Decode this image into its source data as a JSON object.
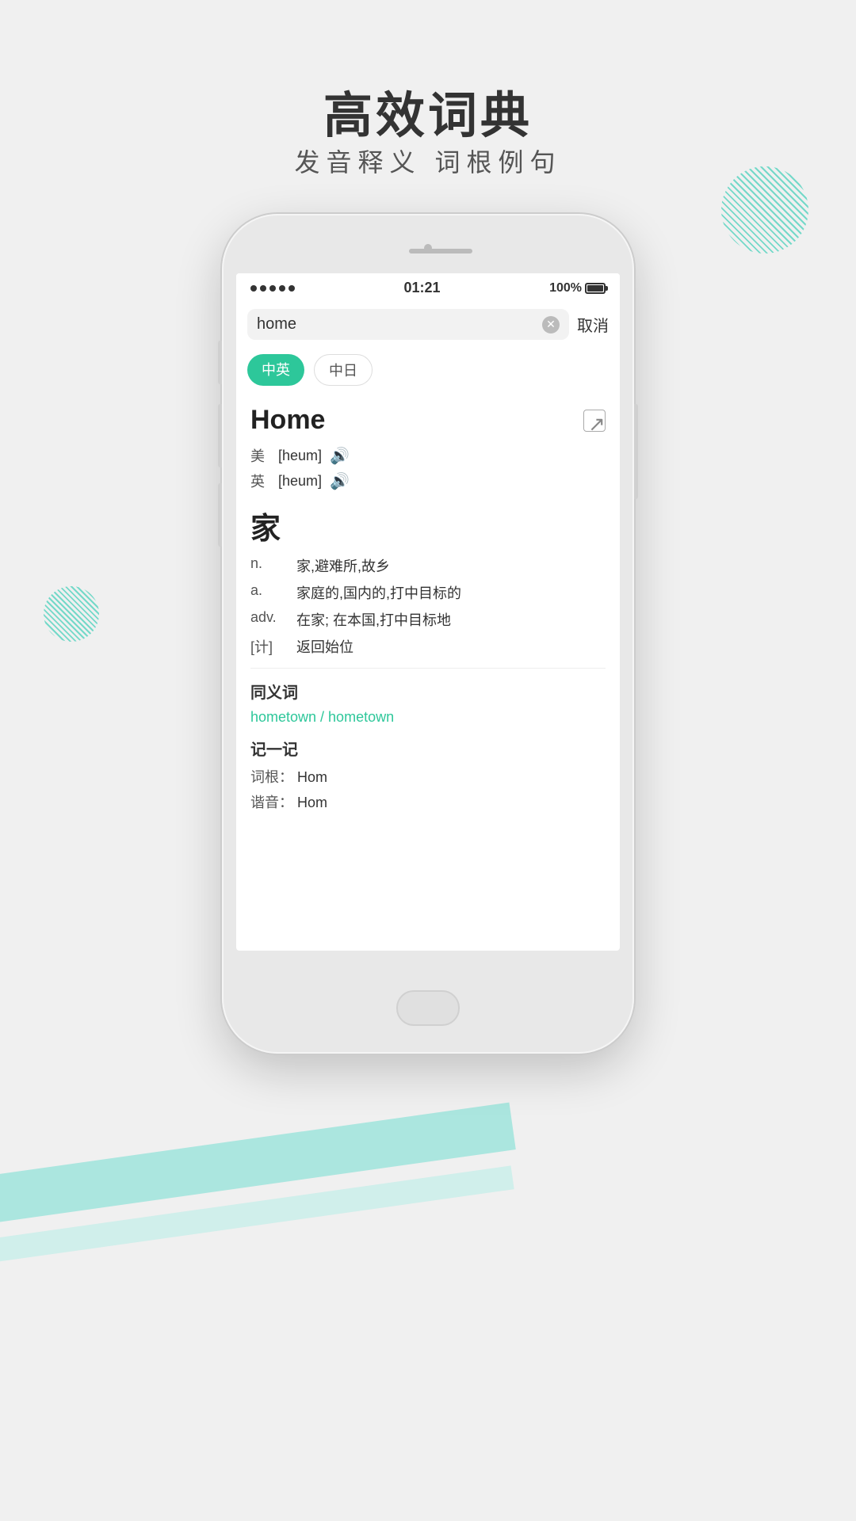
{
  "page": {
    "title": "高效词典",
    "subtitle": "发音释义  词根例句"
  },
  "status_bar": {
    "signal": "•••••",
    "time": "01:21",
    "battery": "100%"
  },
  "search": {
    "query": "home",
    "cancel_label": "取消"
  },
  "language_tabs": [
    {
      "label": "中英",
      "active": true
    },
    {
      "label": "中日",
      "active": false
    }
  ],
  "entry": {
    "word": "Home",
    "share_icon": "↗",
    "pronunciations": [
      {
        "region": "美",
        "phonetic": "[heum]",
        "active": false
      },
      {
        "region": "英",
        "phonetic": "[heum]",
        "active": true
      }
    ],
    "chinese_head": "家",
    "definitions": [
      {
        "pos": "n.",
        "text": "家,避难所,故乡"
      },
      {
        "pos": "a.",
        "text": "家庭的,国内的,打中目标的"
      },
      {
        "pos": "adv.",
        "text": "在家; 在本国,打中目标地"
      },
      {
        "pos": "[计]",
        "text": "返回始位"
      }
    ],
    "synonyms_section": {
      "title": "同义词",
      "links": "hometown / hometown"
    },
    "memory_section": {
      "title": "记一记",
      "root_label": "词根：",
      "root_value": "Hom",
      "sound_label": "谐音：",
      "sound_value": "Hom"
    }
  }
}
